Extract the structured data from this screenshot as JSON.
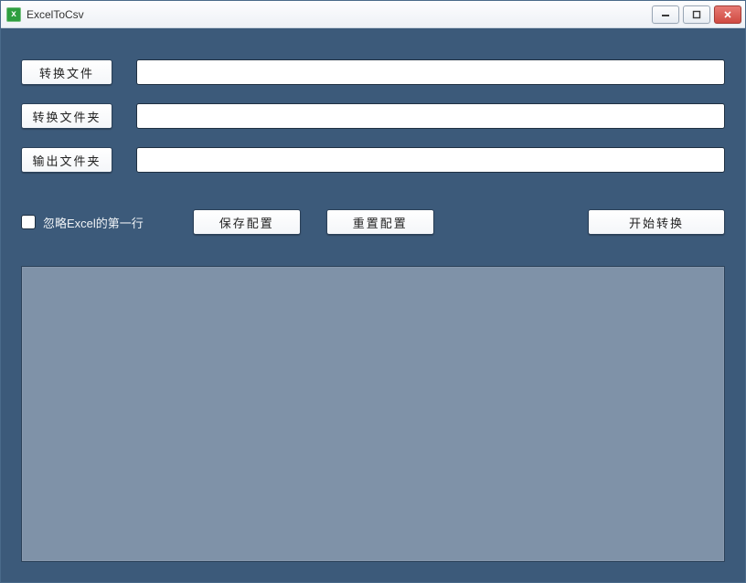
{
  "window": {
    "title": "ExcelToCsv",
    "icon_glyph": "x"
  },
  "buttons": {
    "convert_file": "转换文件",
    "convert_folder": "转换文件夹",
    "output_folder": "输出文件夹",
    "save_config": "保存配置",
    "reset_config": "重置配置",
    "start_convert": "开始转换"
  },
  "inputs": {
    "convert_file_value": "",
    "convert_folder_value": "",
    "output_folder_value": ""
  },
  "options": {
    "ignore_first_row_label": "忽略Excel的第一行",
    "ignore_first_row_checked": false
  },
  "log": {
    "content": ""
  },
  "colors": {
    "client_bg": "#3c5a7a",
    "log_bg": "#7f92a8",
    "button_bg": "#ffffff",
    "border_dark": "#2b4159"
  }
}
